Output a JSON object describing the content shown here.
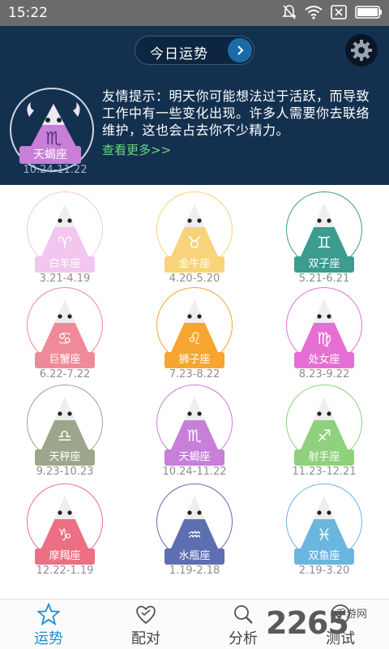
{
  "status_bar": {
    "time": "15:22"
  },
  "header": {
    "today_button": "今日运势",
    "featured_sign": {
      "name": "天蝎座",
      "dates": "10.24-11.22"
    },
    "tip": "友情提示：明天你可能想法过于活跃，而导致工作中有一些变化出现。许多人需要你去联络维护，这也会占去你不少精力。",
    "more_link": "查看更多>>"
  },
  "signs": [
    {
      "name": "白羊座",
      "dates": "3.21-4.19",
      "color": "#f2c6ee",
      "symbol": "♈",
      "icon": "aries-icon"
    },
    {
      "name": "金牛座",
      "dates": "4.20-5.20",
      "color": "#f7d37a",
      "symbol": "♉",
      "icon": "taurus-icon"
    },
    {
      "name": "双子座",
      "dates": "5.21-6.21",
      "color": "#3b9c8f",
      "symbol": "♊",
      "icon": "gemini-icon"
    },
    {
      "name": "巨蟹座",
      "dates": "6.22-7.22",
      "color": "#f08a98",
      "symbol": "♋",
      "icon": "cancer-icon"
    },
    {
      "name": "狮子座",
      "dates": "7.23-8.22",
      "color": "#f6a531",
      "symbol": "♌",
      "icon": "leo-icon"
    },
    {
      "name": "处女座",
      "dates": "8.23-9.22",
      "color": "#e66fd4",
      "symbol": "♍",
      "icon": "virgo-icon"
    },
    {
      "name": "天秤座",
      "dates": "9.23-10.23",
      "color": "#9ba68b",
      "symbol": "♎",
      "icon": "libra-icon"
    },
    {
      "name": "天蝎座",
      "dates": "10.24-11.22",
      "color": "#c77fd8",
      "symbol": "♏",
      "icon": "scorpio-icon"
    },
    {
      "name": "射手座",
      "dates": "11.23-12.21",
      "color": "#8fd17c",
      "symbol": "♐",
      "icon": "sagittarius-icon"
    },
    {
      "name": "摩羯座",
      "dates": "12.22-1.19",
      "color": "#ec6f83",
      "symbol": "♑",
      "icon": "capricorn-icon"
    },
    {
      "name": "水瓶座",
      "dates": "1.19-2.18",
      "color": "#5d6fb0",
      "symbol": "♒",
      "icon": "aquarius-icon"
    },
    {
      "name": "双鱼座",
      "dates": "2.19-3.20",
      "color": "#6bb6df",
      "symbol": "♓",
      "icon": "pisces-icon"
    }
  ],
  "tabs": [
    {
      "label": "运势",
      "active": true,
      "icon": "star-icon"
    },
    {
      "label": "配对",
      "active": false,
      "icon": "heart-icon"
    },
    {
      "label": "分析",
      "active": false,
      "icon": "magnifier-icon"
    },
    {
      "label": "测试",
      "active": false,
      "icon": "check-icon"
    }
  ],
  "watermark": {
    "big": "2265",
    "small": "手游网"
  },
  "colors": {
    "header_bg": "#14304f",
    "accent": "#1a8fd6",
    "link": "#66d97a"
  }
}
